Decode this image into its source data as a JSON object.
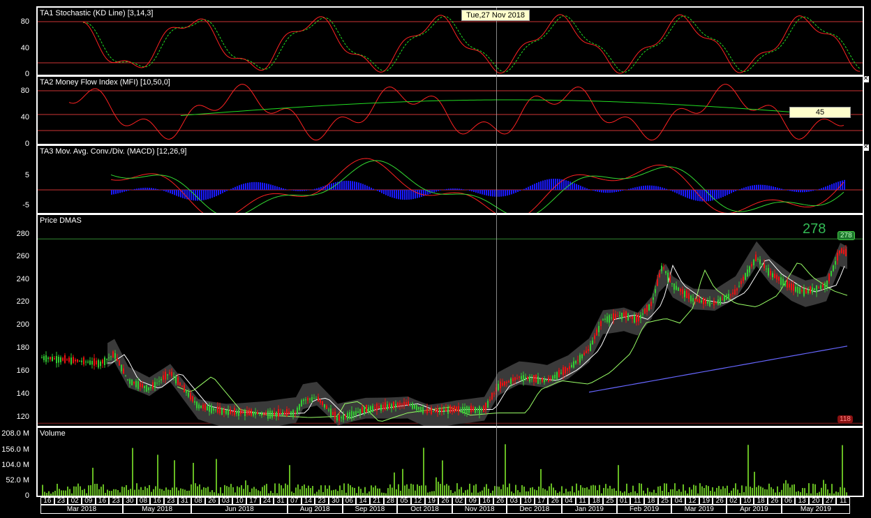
{
  "crosshair": {
    "date_label": "Tue,27 Nov 2018"
  },
  "panels": {
    "stoch": {
      "title": "TA1 Stochastic (KD Line) [3,14,3]",
      "y_ticks": [
        "80",
        "40",
        "0"
      ]
    },
    "mfi": {
      "title": "TA2 Money Flow Index (MFI) [10,50,0]",
      "y_ticks": [
        "80",
        "40",
        "0"
      ],
      "value_label": "45"
    },
    "macd": {
      "title": "TA3 Mov. Avg. Conv./Div. (MACD) [12,26,9]",
      "y_ticks": [
        "5",
        "-5"
      ]
    },
    "price": {
      "title": "Price DMAS",
      "y_ticks": [
        "280",
        "260",
        "240",
        "220",
        "200",
        "180",
        "160",
        "140",
        "120"
      ],
      "high_label": "278",
      "high_badge": "278",
      "low_badge": "118"
    },
    "volume": {
      "title": "Volume",
      "y_ticks": [
        "208.0 M",
        "156.0 M",
        "104.0 M",
        "52.0 M",
        "0"
      ]
    }
  },
  "x_axis": {
    "days": [
      "16",
      "23",
      "02",
      "09",
      "16",
      "23",
      "30",
      "08",
      "16",
      "23",
      "31",
      "08",
      "26",
      "03",
      "10",
      "17",
      "24",
      "31",
      "07",
      "14",
      "23",
      "30",
      "06",
      "14",
      "21",
      "28",
      "05",
      "12",
      "19",
      "26",
      "02",
      "09",
      "16",
      "26",
      "03",
      "10",
      "17",
      "26",
      "04",
      "11",
      "18",
      "25",
      "01",
      "11",
      "18",
      "25",
      "04",
      "12",
      "19",
      "26",
      "02",
      "10",
      "18",
      "26",
      "06",
      "13",
      "20",
      "27",
      "11"
    ],
    "months": [
      "Mar 2018",
      "May 2018",
      "Jun 2018",
      "Aug 2018",
      "Sep 2018",
      "Oct 2018",
      "Nov 2018",
      "Dec 2018",
      "Jan 2019",
      "Feb 2019",
      "Mar 2019",
      "Apr 2019",
      "May 2019"
    ]
  },
  "colors": {
    "price_up": "#33cc33",
    "price_down": "#ee1111",
    "band_fill": "#3a3a3a",
    "volume": "#66bb22",
    "macd_hist": "#1a1aff",
    "mfi_signal": "#22dd22",
    "stoch_d": "#22dd22",
    "long_ma": "#6666ff",
    "grid_line": "#cc3333"
  }
}
